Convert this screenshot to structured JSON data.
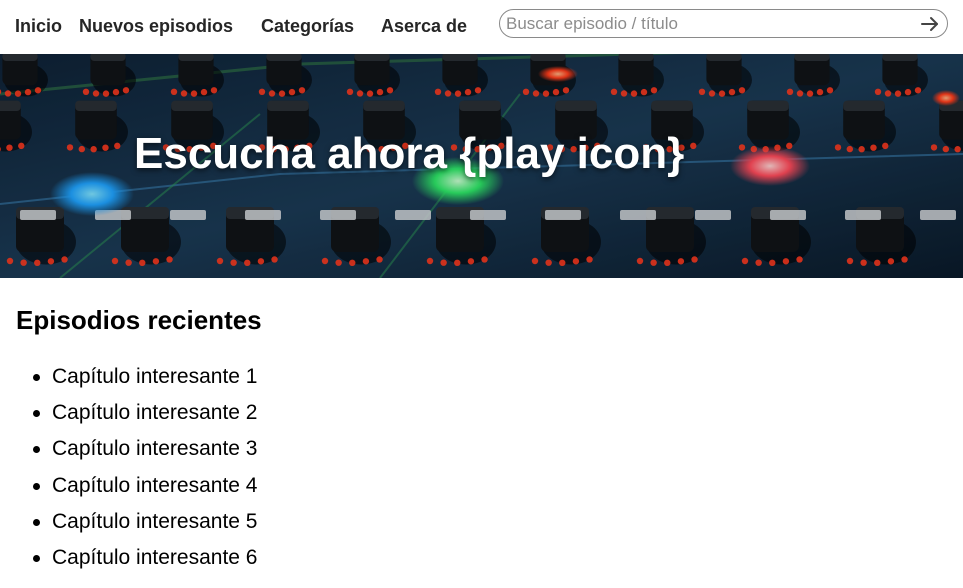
{
  "nav": {
    "items": [
      {
        "label": "Inicio"
      },
      {
        "label": "Nuevos episodios"
      },
      {
        "label": "Categorías"
      },
      {
        "label": "Aserca de"
      }
    ],
    "search": {
      "placeholder": "Buscar episodio / título",
      "submit_icon": "arrow-right-icon"
    }
  },
  "hero": {
    "title": "Escucha ahora {play icon}",
    "background": "audio-mixing-console-image"
  },
  "recent": {
    "title": "Episodios recientes",
    "episodes": [
      {
        "label": "Capítulo interesante 1"
      },
      {
        "label": "Capítulo interesante 2"
      },
      {
        "label": "Capítulo interesante 3"
      },
      {
        "label": "Capítulo interesante 4"
      },
      {
        "label": "Capítulo interesante 5"
      },
      {
        "label": "Capítulo interesante 6"
      }
    ]
  }
}
